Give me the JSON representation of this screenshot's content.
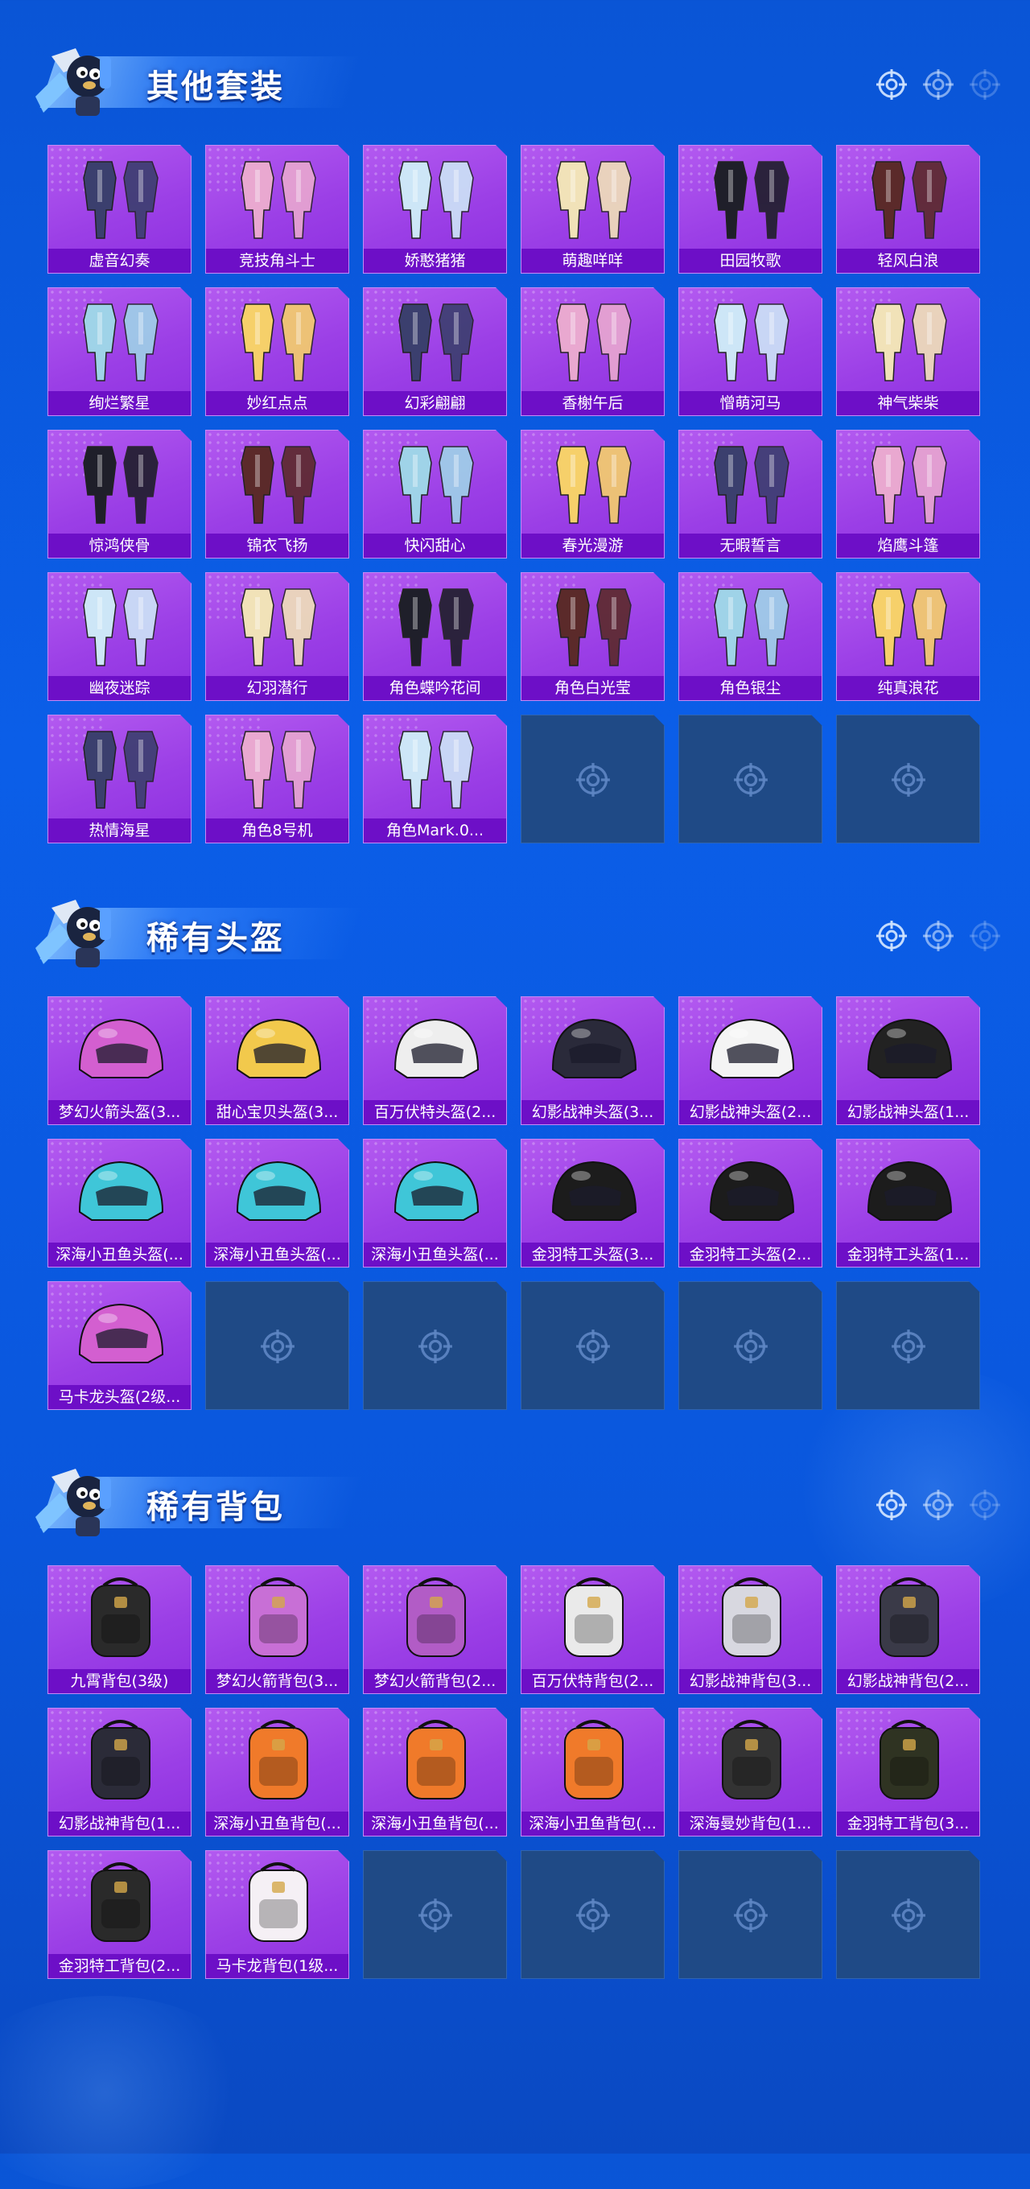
{
  "colors": {
    "background": "#0a55d6",
    "card": "#a64cec",
    "label_bar": "#6d0fc7",
    "empty_slot": "#1f4a86"
  },
  "sections": [
    {
      "title": "其他套装",
      "icon": "outfit-icon",
      "items": [
        "虚音幻奏",
        "竞技角斗士",
        "娇憨猪猪",
        "萌趣咩咩",
        "田园牧歌",
        "轻风白浪",
        "绚烂繁星",
        "妙红点点",
        "幻彩翩翩",
        "香榭午后",
        "憎萌河马",
        "神气柴柴",
        "惊鸿侠骨",
        "锦衣飞扬",
        "快闪甜心",
        "春光漫游",
        "无暇誓言",
        "焰鹰斗篷",
        "幽夜迷踪",
        "幻羽潜行",
        "角色蝶吟花间",
        "角色白光莹",
        "角色银尘",
        "纯真浪花",
        "热情海星",
        "角色8号机",
        "角色Mark.0..."
      ],
      "empty_slots": 3
    },
    {
      "title": "稀有头盔",
      "icon": "helmet-icon",
      "items": [
        "梦幻火箭头盔(3...",
        "甜心宝贝头盔(3...",
        "百万伏特头盔(2...",
        "幻影战神头盔(3...",
        "幻影战神头盔(2...",
        "幻影战神头盔(1...",
        "深海小丑鱼头盔(...",
        "深海小丑鱼头盔(...",
        "深海小丑鱼头盔(...",
        "金羽特工头盔(3...",
        "金羽特工头盔(2...",
        "金羽特工头盔(1...",
        "马卡龙头盔(2级..."
      ],
      "empty_slots": 5
    },
    {
      "title": "稀有背包",
      "icon": "backpack-icon",
      "items": [
        "九霄背包(3级)",
        "梦幻火箭背包(3...",
        "梦幻火箭背包(2...",
        "百万伏特背包(2...",
        "幻影战神背包(3...",
        "幻影战神背包(2...",
        "幻影战神背包(1...",
        "深海小丑鱼背包(...",
        "深海小丑鱼背包(...",
        "深海小丑鱼背包(...",
        "深海曼妙背包(1...",
        "金羽特工背包(3...",
        "金羽特工背包(2...",
        "马卡龙背包(1级..."
      ],
      "empty_slots": 4
    }
  ]
}
